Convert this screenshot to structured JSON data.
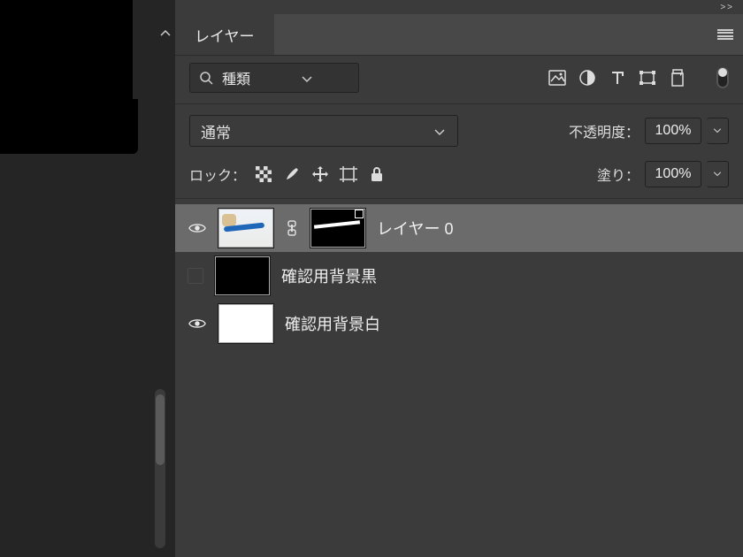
{
  "panel": {
    "tab_title": "レイヤー",
    "expand_text": ">>"
  },
  "filter": {
    "value": "種類"
  },
  "blend": {
    "mode": "通常",
    "opacity_label": "不透明度：",
    "opacity_value": "100%"
  },
  "lock": {
    "label": "ロック：",
    "fill_label": "塗り：",
    "fill_value": "100%"
  },
  "layers": [
    {
      "visible": true,
      "name": "レイヤー 0",
      "selected": true,
      "has_mask": true,
      "thumb": "photo"
    },
    {
      "visible": false,
      "name": "確認用背景黒",
      "selected": false,
      "has_mask": false,
      "thumb": "black"
    },
    {
      "visible": true,
      "name": "確認用背景白",
      "selected": false,
      "has_mask": false,
      "thumb": "white"
    }
  ]
}
